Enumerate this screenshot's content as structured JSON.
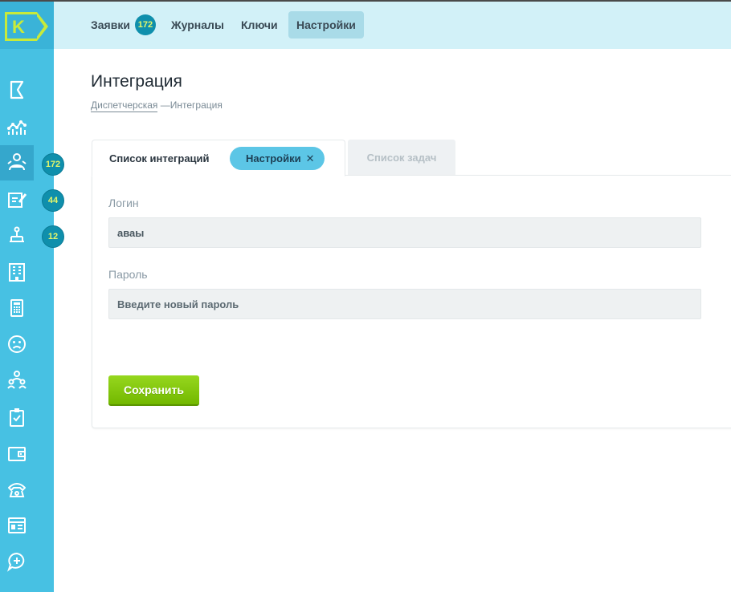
{
  "app": {
    "logo_letter": "K"
  },
  "sidebar": {
    "items": [
      {
        "icon": "flag-icon"
      },
      {
        "icon": "analytics-icon"
      },
      {
        "icon": "group-icon",
        "badge": "172",
        "active": true
      },
      {
        "icon": "edit-note-icon",
        "badge": "44"
      },
      {
        "icon": "keys-icon",
        "badge": "12"
      },
      {
        "icon": "building-icon"
      },
      {
        "icon": "calculator-icon"
      },
      {
        "icon": "sad-face-icon"
      },
      {
        "icon": "users-icon"
      },
      {
        "icon": "clipboard-check-icon"
      },
      {
        "icon": "wallet-icon"
      },
      {
        "icon": "phone-icon"
      },
      {
        "icon": "id-card-icon"
      },
      {
        "icon": "chat-add-icon"
      }
    ]
  },
  "topnav": {
    "items": [
      {
        "label": "Заявки",
        "badge": "172"
      },
      {
        "label": "Журналы"
      },
      {
        "label": "Ключи"
      },
      {
        "label": "Настройки",
        "active": true
      }
    ]
  },
  "page": {
    "title": "Интеграция",
    "breadcrumb": {
      "link": "Диспетчерская",
      "separator": "—",
      "current": "Интеграция"
    }
  },
  "tabs": {
    "active_label": "Список интеграций",
    "pill_label": "Настройки",
    "pill_close": "✕",
    "inactive_label": "Список задач"
  },
  "form": {
    "login_label": "Логин",
    "login_value": "аваы",
    "password_label": "Пароль",
    "password_placeholder": "Введите новый пароль",
    "save_label": "Сохранить"
  },
  "colors": {
    "sidebar": "#47c1e3",
    "topbar": "#d2f1f8",
    "badge": "#0f8fac",
    "accent_lime": "#c8ea3a",
    "save_button": "#7fc40a"
  }
}
